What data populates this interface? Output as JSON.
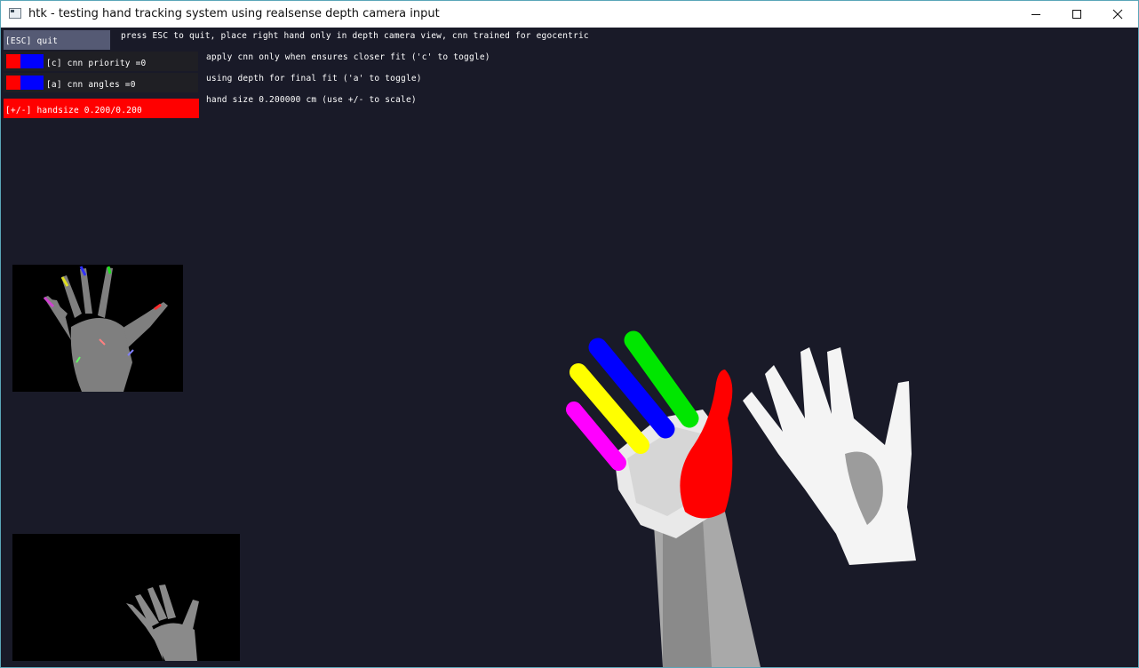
{
  "window": {
    "title": "htk - testing hand tracking system  using realsense depth camera input"
  },
  "icons": {
    "app": "app-window-icon",
    "minimize": "minimize-icon",
    "maximize": "maximize-icon",
    "close": "close-icon"
  },
  "controls": {
    "esc_label": "[ESC] quit",
    "cnn_priority_label": "[c] cnn priority =0",
    "cnn_angles_label": "[a] cnn angles   =0",
    "handsize_label": "[+/-] handsize 0.200/0.200",
    "handsize_fraction": 1.0
  },
  "info": {
    "esc_hint": "press ESC to quit,  place right hand only in depth camera view, cnn trained for egocentric",
    "cnn_hint": "apply cnn only when ensures closer fit   ('c' to toggle)",
    "depth_hint": "using depth for final fit   ('a' to toggle)",
    "size_hint": "hand size  0.200000 cm   (use +/- to scale)"
  },
  "colors": {
    "background": "#191a28",
    "esc_button": "#555a74",
    "swatch_red": "#ff0000",
    "swatch_blue": "#0000ff",
    "finger_thumb": "#ff0000",
    "finger_index": "#00ee00",
    "finger_middle": "#0000ff",
    "finger_ring": "#ffff00",
    "finger_pinky": "#ff00ff"
  }
}
